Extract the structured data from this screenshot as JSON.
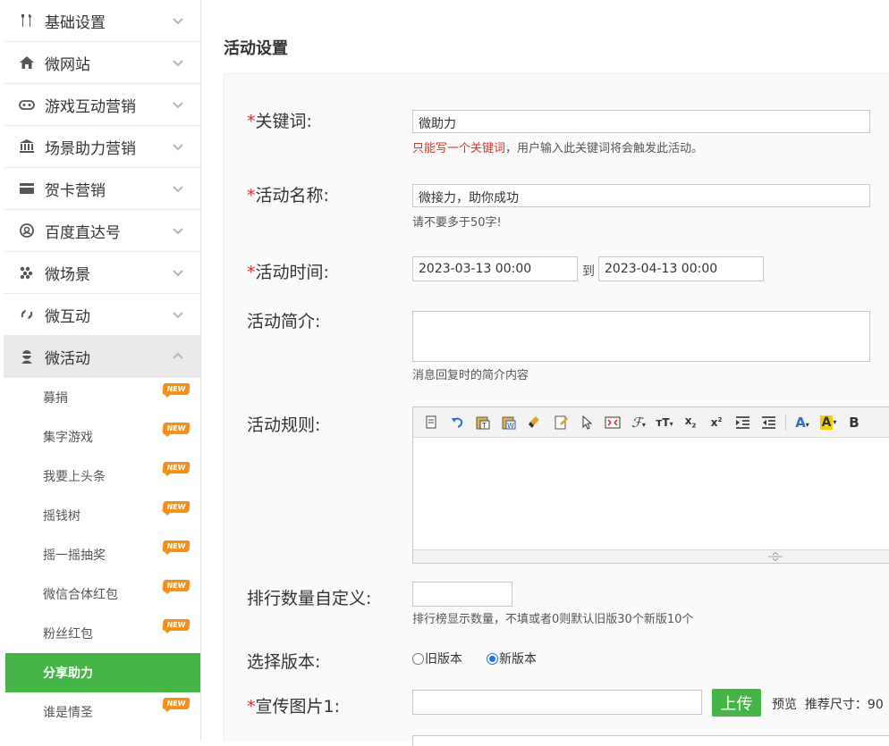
{
  "sidebar": {
    "menu": [
      {
        "label": "基础设置",
        "icon": "tools-icon"
      },
      {
        "label": "微网站",
        "icon": "home-icon"
      },
      {
        "label": "游戏互动营销",
        "icon": "gamepad-icon"
      },
      {
        "label": "场景助力营销",
        "icon": "bank-icon"
      },
      {
        "label": "贺卡营销",
        "icon": "card-icon"
      },
      {
        "label": "百度直达号",
        "icon": "at-icon"
      },
      {
        "label": "微场景",
        "icon": "dots-icon"
      },
      {
        "label": "微互动",
        "icon": "swirl-icon"
      },
      {
        "label": "微活动",
        "icon": "user-icon"
      }
    ],
    "submenu": [
      {
        "label": "募捐",
        "badge": "NEW"
      },
      {
        "label": "集字游戏",
        "badge": "NEW"
      },
      {
        "label": "我要上头条",
        "badge": "NEW"
      },
      {
        "label": "摇钱树",
        "badge": "NEW"
      },
      {
        "label": "摇一摇抽奖",
        "badge": "NEW"
      },
      {
        "label": "微信合体红包",
        "badge": "NEW"
      },
      {
        "label": "粉丝红包",
        "badge": "NEW"
      },
      {
        "label": "分享助力",
        "badge": ""
      },
      {
        "label": "谁是情圣",
        "badge": "NEW"
      }
    ]
  },
  "main": {
    "title": "活动设置",
    "required_mark": "*",
    "keyword": {
      "label": "关键词:",
      "value": "微助力",
      "hint_red": "只能写一个关键词",
      "hint_rest": "，用户输入此关键词将会触发此活动。"
    },
    "name": {
      "label": "活动名称:",
      "value": "微接力，助你成功",
      "hint": "请不要多于50字!"
    },
    "time": {
      "label": "活动时间:",
      "start": "2023-03-13 00:00",
      "to": "到",
      "end": "2023-04-13 00:00"
    },
    "intro": {
      "label": "活动简介:",
      "hint": "消息回复时的简介内容"
    },
    "rules": {
      "label": "活动规则:",
      "toolbar": [
        "copy-icon",
        "undo-icon",
        "paste-text-icon",
        "paste-word-icon",
        "clear-format-icon",
        "format-painter-icon",
        "select-icon",
        "fullscreen-icon",
        "font-family-icon",
        "font-size-icon",
        "subscript-icon",
        "superscript-icon",
        "indent-icon",
        "outdent-icon",
        "font-color-icon",
        "highlight-icon",
        "bold-icon"
      ]
    },
    "rank": {
      "label": "排行数量自定义:",
      "value": "",
      "hint": "排行榜显示数量，不填或者0则默认旧版30个新版10个"
    },
    "version": {
      "label": "选择版本:",
      "old": "旧版本",
      "new": "新版本",
      "selected": "new"
    },
    "image": {
      "label": "宣传图片1:",
      "value": "",
      "upload": "上传",
      "preview": "预览",
      "size_hint": "推荐尺寸：90"
    }
  }
}
